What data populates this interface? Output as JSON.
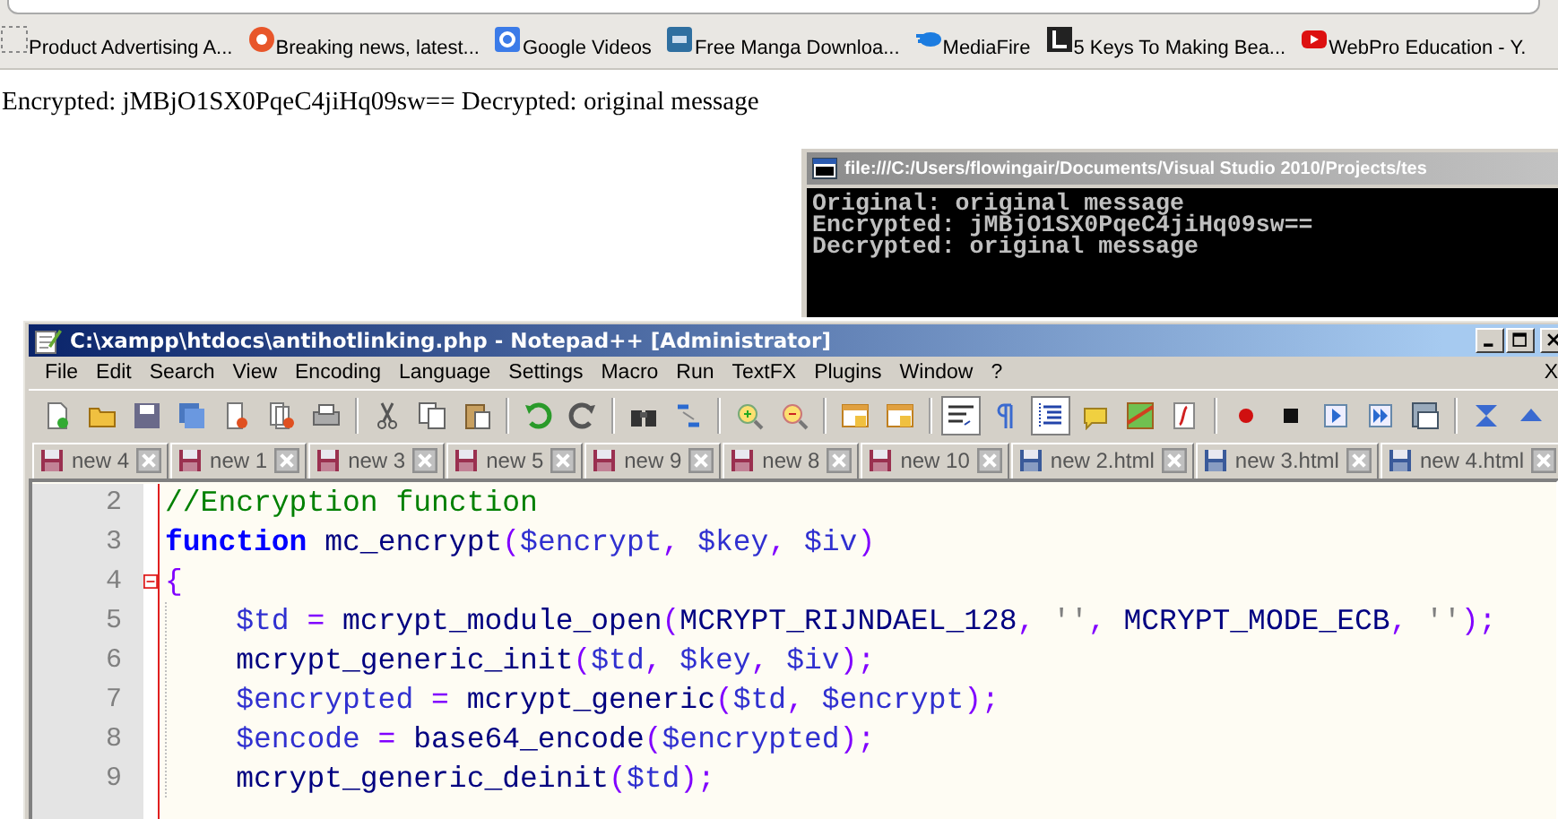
{
  "bookmarks": [
    {
      "label": "Product Advertising A..."
    },
    {
      "label": "Breaking news, latest..."
    },
    {
      "label": "Google Videos"
    },
    {
      "label": "Free Manga Downloa..."
    },
    {
      "label": "MediaFire"
    },
    {
      "label": "5 Keys To Making Bea..."
    },
    {
      "label": "WebPro Education - Y."
    }
  ],
  "page_text": "Encrypted: jMBjO1SX0PqeC4jiHq09sw== Decrypted: original message",
  "console": {
    "title": "file:///C:/Users/flowingair/Documents/Visual Studio 2010/Projects/tes",
    "lines": [
      "Original: original message",
      "Encrypted: jMBjO1SX0PqeC4jiHq09sw==",
      "Decrypted: original message"
    ]
  },
  "editor_window": {
    "title": "C:\\xampp\\htdocs\\antihotlinking.php - Notepad++ [Administrator]",
    "menu": [
      "File",
      "Edit",
      "Search",
      "View",
      "Encoding",
      "Language",
      "Settings",
      "Macro",
      "Run",
      "TextFX",
      "Plugins",
      "Window",
      "?"
    ],
    "close_document": "X",
    "tabs": [
      {
        "label": "new 4",
        "modified": true
      },
      {
        "label": "new 1",
        "modified": true
      },
      {
        "label": "new 3",
        "modified": true
      },
      {
        "label": "new 5",
        "modified": true
      },
      {
        "label": "new 9",
        "modified": true
      },
      {
        "label": "new 8",
        "modified": true
      },
      {
        "label": "new 10",
        "modified": true
      },
      {
        "label": "new 2.html",
        "modified": false
      },
      {
        "label": "new 3.html",
        "modified": false
      },
      {
        "label": "new 4.html",
        "modified": false
      }
    ],
    "lines": [
      {
        "number": "2",
        "indent": false,
        "fold": false,
        "tokens": [
          {
            "kind": "comment",
            "text": "//Encryption function"
          }
        ]
      },
      {
        "number": "3",
        "indent": false,
        "fold": false,
        "tokens": [
          {
            "kind": "keyword",
            "text": "function"
          },
          {
            "kind": "plain",
            "text": " mc_encrypt"
          },
          {
            "kind": "operator",
            "text": "("
          },
          {
            "kind": "variable",
            "text": "$encrypt"
          },
          {
            "kind": "operator",
            "text": ", "
          },
          {
            "kind": "variable",
            "text": "$key"
          },
          {
            "kind": "operator",
            "text": ", "
          },
          {
            "kind": "variable",
            "text": "$iv"
          },
          {
            "kind": "operator",
            "text": ")"
          }
        ]
      },
      {
        "number": "4",
        "indent": false,
        "fold": true,
        "tokens": [
          {
            "kind": "operator",
            "text": "{"
          }
        ]
      },
      {
        "number": "5",
        "indent": true,
        "fold": false,
        "tokens": [
          {
            "kind": "variable",
            "text": "$td"
          },
          {
            "kind": "operator",
            "text": " = "
          },
          {
            "kind": "plain",
            "text": "mcrypt_module_open"
          },
          {
            "kind": "operator",
            "text": "("
          },
          {
            "kind": "plain",
            "text": "MCRYPT_RIJNDAEL_128"
          },
          {
            "kind": "operator",
            "text": ", "
          },
          {
            "kind": "string",
            "text": "''"
          },
          {
            "kind": "operator",
            "text": ", "
          },
          {
            "kind": "plain",
            "text": "MCRYPT_MODE_ECB"
          },
          {
            "kind": "operator",
            "text": ", "
          },
          {
            "kind": "string",
            "text": "''"
          },
          {
            "kind": "operator",
            "text": ");"
          }
        ]
      },
      {
        "number": "6",
        "indent": true,
        "fold": false,
        "tokens": [
          {
            "kind": "plain",
            "text": "mcrypt_generic_init"
          },
          {
            "kind": "operator",
            "text": "("
          },
          {
            "kind": "variable",
            "text": "$td"
          },
          {
            "kind": "operator",
            "text": ", "
          },
          {
            "kind": "variable",
            "text": "$key"
          },
          {
            "kind": "operator",
            "text": ", "
          },
          {
            "kind": "variable",
            "text": "$iv"
          },
          {
            "kind": "operator",
            "text": ");"
          }
        ]
      },
      {
        "number": "7",
        "indent": true,
        "fold": false,
        "tokens": [
          {
            "kind": "variable",
            "text": "$encrypted"
          },
          {
            "kind": "operator",
            "text": " = "
          },
          {
            "kind": "plain",
            "text": "mcrypt_generic"
          },
          {
            "kind": "operator",
            "text": "("
          },
          {
            "kind": "variable",
            "text": "$td"
          },
          {
            "kind": "operator",
            "text": ", "
          },
          {
            "kind": "variable",
            "text": "$encrypt"
          },
          {
            "kind": "operator",
            "text": ");"
          }
        ]
      },
      {
        "number": "8",
        "indent": true,
        "fold": false,
        "tokens": [
          {
            "kind": "variable",
            "text": "$encode"
          },
          {
            "kind": "operator",
            "text": " = "
          },
          {
            "kind": "plain",
            "text": "base64_encode"
          },
          {
            "kind": "operator",
            "text": "("
          },
          {
            "kind": "variable",
            "text": "$encrypted"
          },
          {
            "kind": "operator",
            "text": ");"
          }
        ]
      },
      {
        "number": "9",
        "indent": true,
        "fold": false,
        "tokens": [
          {
            "kind": "plain",
            "text": "mcrypt_generic_deinit"
          },
          {
            "kind": "operator",
            "text": "("
          },
          {
            "kind": "variable",
            "text": "$td"
          },
          {
            "kind": "operator",
            "text": ");"
          }
        ]
      }
    ]
  }
}
